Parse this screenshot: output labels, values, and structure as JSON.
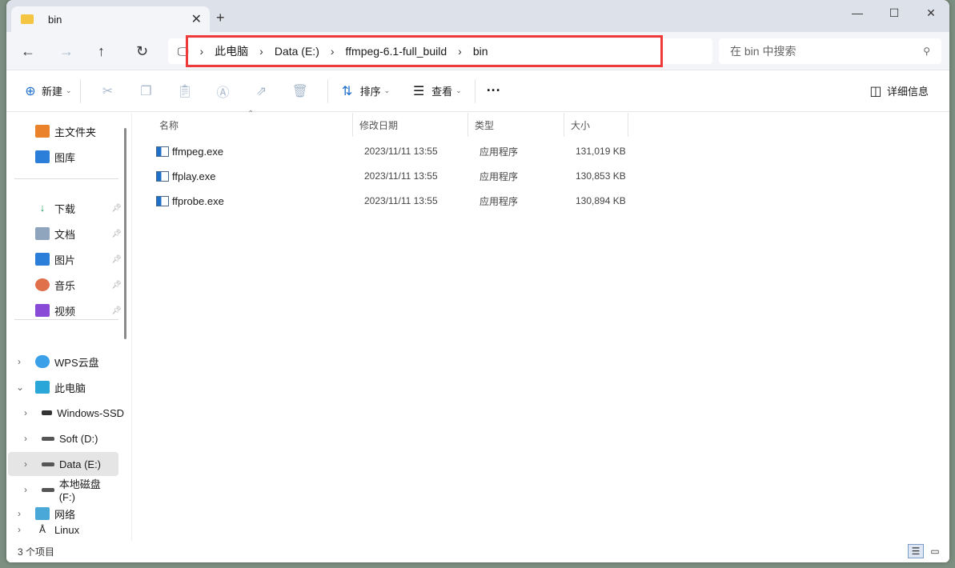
{
  "tab": {
    "title": "bin",
    "close": "✕",
    "new": "+"
  },
  "window": {
    "minimize": "—",
    "maximize": "☐",
    "close": "✕"
  },
  "nav": {
    "back": "←",
    "forward": "→",
    "up": "↑",
    "refresh": "↻"
  },
  "breadcrumb": [
    "此电脑",
    "Data (E:)",
    "ffmpeg-6.1-full_build",
    "bin"
  ],
  "search": {
    "placeholder": "在 bin 中搜索"
  },
  "toolbar": {
    "new": "新建",
    "sort": "排序",
    "view": "查看",
    "more": "···",
    "details": "详细信息"
  },
  "sidebar": {
    "quick": [
      {
        "label": "主文件夹"
      },
      {
        "label": "图库"
      }
    ],
    "pinned": [
      {
        "label": "下载"
      },
      {
        "label": "文档"
      },
      {
        "label": "图片"
      },
      {
        "label": "音乐"
      },
      {
        "label": "视频"
      }
    ],
    "tree": [
      {
        "label": "WPS云盘"
      },
      {
        "label": "此电脑"
      },
      {
        "label": "Windows-SSD"
      },
      {
        "label": "Soft (D:)"
      },
      {
        "label": "Data (E:)"
      },
      {
        "label": "本地磁盘 (F:)"
      },
      {
        "label": "网络"
      },
      {
        "label": "Linux"
      }
    ]
  },
  "columns": [
    "名称",
    "修改日期",
    "类型",
    "大小"
  ],
  "files": [
    {
      "name": "ffmpeg.exe",
      "date": "2023/11/11 13:55",
      "type": "应用程序",
      "size": "131,019 KB"
    },
    {
      "name": "ffplay.exe",
      "date": "2023/11/11 13:55",
      "type": "应用程序",
      "size": "130,853 KB"
    },
    {
      "name": "ffprobe.exe",
      "date": "2023/11/11 13:55",
      "type": "应用程序",
      "size": "130,894 KB"
    }
  ],
  "status": {
    "count": "3 个项目"
  },
  "colors": {
    "highlight": "#f03a3a",
    "selected": "#e5e5e5"
  }
}
